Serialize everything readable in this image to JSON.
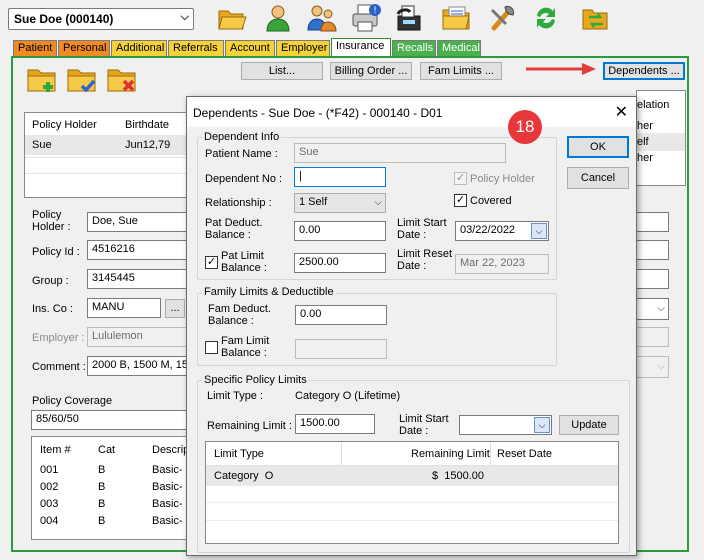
{
  "patient_selector": {
    "value": "Sue Doe (000140)"
  },
  "toolbar_icons": [
    "folder-open-icon",
    "person-icon",
    "family-icon",
    "print-icon",
    "fax-icon",
    "notes-icon",
    "tools-icon",
    "refresh-icon",
    "folder-swap-icon"
  ],
  "tabs": [
    {
      "label": "Patient",
      "color": "#f08a24"
    },
    {
      "label": "Personal",
      "color": "#f08a24"
    },
    {
      "label": "Additional",
      "color": "#f5d23a"
    },
    {
      "label": "Referrals",
      "color": "#f5d23a"
    },
    {
      "label": "Account",
      "color": "#f5d23a"
    },
    {
      "label": "Employer",
      "color": "#f5d23a"
    },
    {
      "label": "Insurance",
      "color": "#ffffff"
    },
    {
      "label": "Recalls",
      "color": "#4caf50"
    },
    {
      "label": "Medical",
      "color": "#4caf50"
    }
  ],
  "insurance": {
    "buttons": {
      "list": "List...",
      "billing_order": "Billing Order ...",
      "fam_limits": "Fam Limits ...",
      "dependents": "Dependents ..."
    },
    "policy_grid": {
      "headers": [
        "Policy Holder",
        "Birthdate"
      ],
      "row": [
        "Sue",
        "Jun12,79"
      ]
    },
    "relation_grid": {
      "header": "elation",
      "rows": [
        "her",
        "elf",
        "her"
      ]
    },
    "labels": {
      "policy_holder": "Policy\nHolder :",
      "policy_id": "Policy Id :",
      "group": "Group :",
      "ins_co": "Ins. Co :",
      "employer": "Employer :",
      "comment": "Comment :",
      "policy_coverage": "Policy Coverage"
    },
    "values": {
      "policy_holder": "Doe, Sue",
      "policy_id": "4516216",
      "group": "3145445",
      "ins_co": "MANU",
      "ins_co_button": "...",
      "employer": "Lululemon",
      "comment": "2000 B, 1500 M, 15",
      "coverage": "85/60/50"
    },
    "items_grid": {
      "headers": [
        "Item #",
        "Cat",
        "Descrip"
      ],
      "rows": [
        [
          "001",
          "B",
          "Basic-"
        ],
        [
          "002",
          "B",
          "Basic-"
        ],
        [
          "003",
          "B",
          "Basic-"
        ],
        [
          "004",
          "B",
          "Basic-"
        ]
      ]
    }
  },
  "dialog": {
    "title": "Dependents - Sue Doe - (*F42) - 000140 - D01",
    "badge": "18",
    "ok_label": "OK",
    "cancel_label": "Cancel",
    "dependent_info": {
      "group_title": "Dependent Info",
      "patient_name_label": "Patient Name :",
      "patient_name_value": "Sue",
      "dependent_no_label": "Dependent No :",
      "dependent_no_value": "|",
      "policy_holder_label": "Policy Holder",
      "policy_holder_checked": true,
      "relationship_label": "Relationship :",
      "relationship_value": "1 Self",
      "covered_label": "Covered",
      "covered_checked": true,
      "pat_deduct_label": "Pat Deduct.\nBalance :",
      "pat_deduct_value": "0.00",
      "limit_start_label": "Limit Start\nDate :",
      "limit_start_value": "03/22/2022",
      "pat_limit_label": "Pat Limit\nBalance :",
      "pat_limit_checked": true,
      "pat_limit_value": "2500.00",
      "limit_reset_label": "Limit Reset\nDate :",
      "limit_reset_value": "Mar 22, 2023"
    },
    "family": {
      "group_title": "Family Limits & Deductible",
      "fam_deduct_label": "Fam Deduct.\nBalance :",
      "fam_deduct_value": "0.00",
      "fam_limit_label": "Fam Limit\nBalance :",
      "fam_limit_checked": false,
      "fam_limit_value": ""
    },
    "specific": {
      "group_title": "Specific Policy Limits",
      "limit_type_label": "Limit Type :",
      "limit_type_value": "Category O (Lifetime)",
      "remaining_label": "Remaining Limit :",
      "remaining_value": "1500.00",
      "limit_start_label": "Limit Start\nDate :",
      "limit_start_value": "",
      "update_label": "Update",
      "grid_headers": [
        "Limit Type",
        "Remaining Limit",
        "Reset Date"
      ],
      "grid_rows": [
        [
          "Category  O",
          "$  1500.00",
          ""
        ]
      ]
    }
  },
  "colors": {
    "panel_border": "#2b9a3c",
    "arrow": "#e33b3b",
    "badge": "#e8373a"
  }
}
